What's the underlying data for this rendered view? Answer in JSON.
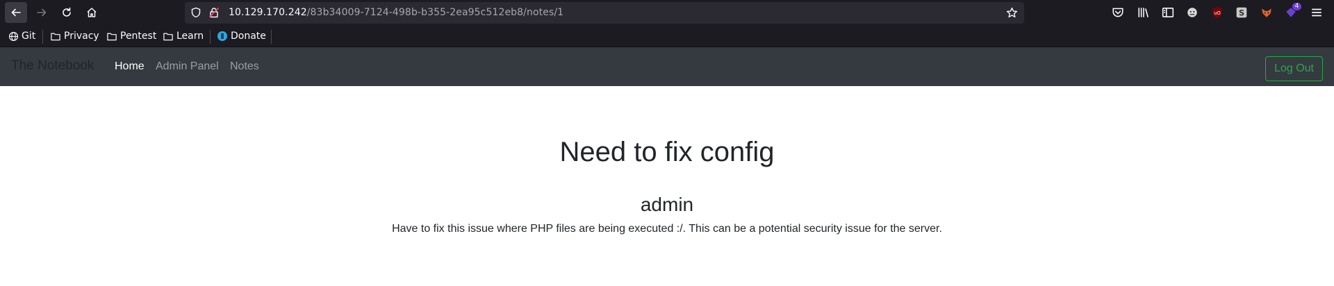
{
  "browser": {
    "url_host": "10.129.170.242",
    "url_path": "/83b34009-7124-498b-b355-2ea95c512eb8/notes/1",
    "extension_badge": "4"
  },
  "bookmarks": [
    {
      "label": "Git",
      "icon": "globe-icon"
    },
    {
      "label": "Privacy",
      "icon": "folder-icon"
    },
    {
      "label": "Pentest",
      "icon": "folder-icon"
    },
    {
      "label": "Learn",
      "icon": "folder-icon"
    },
    {
      "label": "Donate",
      "icon": "donate-icon"
    }
  ],
  "navbar": {
    "brand": "The Notebook",
    "links": [
      "Home",
      "Admin Panel",
      "Notes"
    ],
    "logout": "Log Out"
  },
  "note": {
    "title": "Need to fix config",
    "author": "admin",
    "body": "Have to fix this issue where PHP files are being executed :/. This can be a potential security issue for the server."
  },
  "colors": {
    "navbar_bg": "#343a40",
    "logout_accent": "#28a745",
    "chrome_bg": "#1c1b22"
  }
}
